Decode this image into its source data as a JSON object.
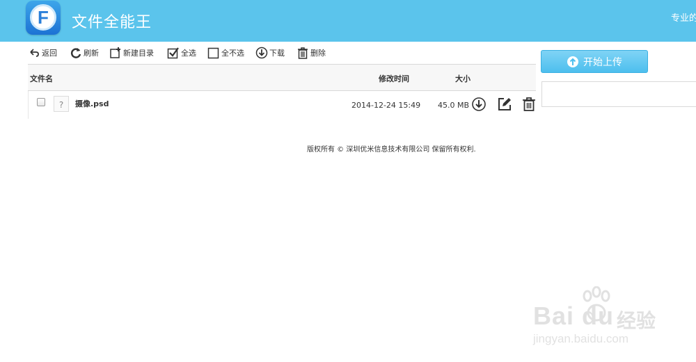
{
  "header": {
    "title": "文件全能王",
    "logo_letter": "F",
    "right_text": "专业的"
  },
  "toolbar": {
    "back": "返回",
    "refresh": "刷新",
    "new_folder": "新建目录",
    "select_all": "全选",
    "select_none": "全不选",
    "download": "下载",
    "delete": "删除"
  },
  "table": {
    "headers": {
      "name": "文件名",
      "modified": "修改时间",
      "size": "大小"
    },
    "rows": [
      {
        "name": "摄像.psd",
        "modified": "2014-12-24 15:49",
        "size": "45.0 MB",
        "icon": "?"
      }
    ]
  },
  "upload": {
    "label": "开始上传"
  },
  "footer": {
    "copyright": "版权所有 © 深圳优米信息技术有限公司 保留所有权利."
  },
  "watermark": {
    "brand": "Bai du",
    "cn": "经验",
    "url": "jingyan.baidu.com"
  },
  "colors": {
    "header_bg": "#5bc4ec",
    "upload_btn": "#4dbfee"
  }
}
